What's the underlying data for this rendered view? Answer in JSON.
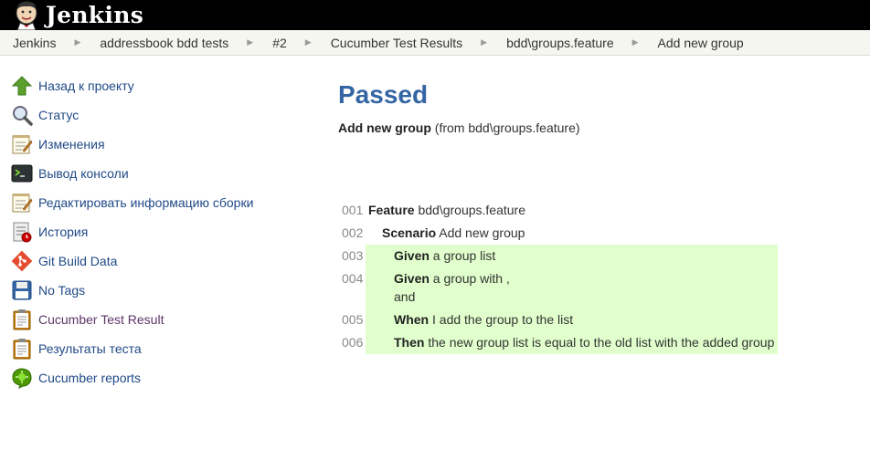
{
  "header": {
    "app_name": "Jenkins"
  },
  "breadcrumb": [
    "Jenkins",
    "addressbook bdd tests",
    "#2",
    "Cucumber Test Results",
    "bdd\\groups.feature",
    "Add new group"
  ],
  "sidebar": {
    "items": [
      {
        "label": "Назад к проекту",
        "icon": "arrow-up-icon",
        "visited": false
      },
      {
        "label": "Статус",
        "icon": "magnifier-icon",
        "visited": false
      },
      {
        "label": "Изменения",
        "icon": "notepad-icon",
        "visited": false
      },
      {
        "label": "Вывод консоли",
        "icon": "terminal-icon",
        "visited": false
      },
      {
        "label": "Редактировать информацию сборки",
        "icon": "notepad-icon",
        "visited": false
      },
      {
        "label": "История",
        "icon": "history-icon",
        "visited": false
      },
      {
        "label": "Git Build Data",
        "icon": "git-icon",
        "visited": false
      },
      {
        "label": "No Tags",
        "icon": "floppy-icon",
        "visited": false
      },
      {
        "label": "Cucumber Test Result",
        "icon": "clipboard-icon",
        "visited": true
      },
      {
        "label": "Результаты теста",
        "icon": "clipboard-icon",
        "visited": false
      },
      {
        "label": "Cucumber reports",
        "icon": "cucumber-icon",
        "visited": false
      }
    ]
  },
  "main": {
    "status": "Passed",
    "scenario_name": "Add new group",
    "scenario_from": "(from bdd\\groups.feature)"
  },
  "steps": [
    {
      "num": "001",
      "keyword": "Feature",
      "text": " bdd\\groups.feature",
      "text2": "",
      "level": 0,
      "passed": false
    },
    {
      "num": "002",
      "keyword": "Scenario",
      "text": " Add new group",
      "text2": "",
      "level": 1,
      "passed": false
    },
    {
      "num": "003",
      "keyword": "Given",
      "text": " a group list",
      "text2": "",
      "level": 2,
      "passed": true
    },
    {
      "num": "004",
      "keyword": "Given",
      "text": " a group with ,",
      "text2": "and",
      "level": 2,
      "passed": true
    },
    {
      "num": "005",
      "keyword": "When",
      "text": " I add the group to the list",
      "text2": "",
      "level": 2,
      "passed": true
    },
    {
      "num": "006",
      "keyword": "Then",
      "text": " the new group list is equal to the old list with the added group",
      "text2": "",
      "level": 2,
      "passed": true
    }
  ],
  "colors": {
    "header_bg": "#000000",
    "link": "#204a87",
    "visited_link": "#5c3566",
    "title": "#3465a4",
    "passed_bg": "#e0ffcc"
  }
}
